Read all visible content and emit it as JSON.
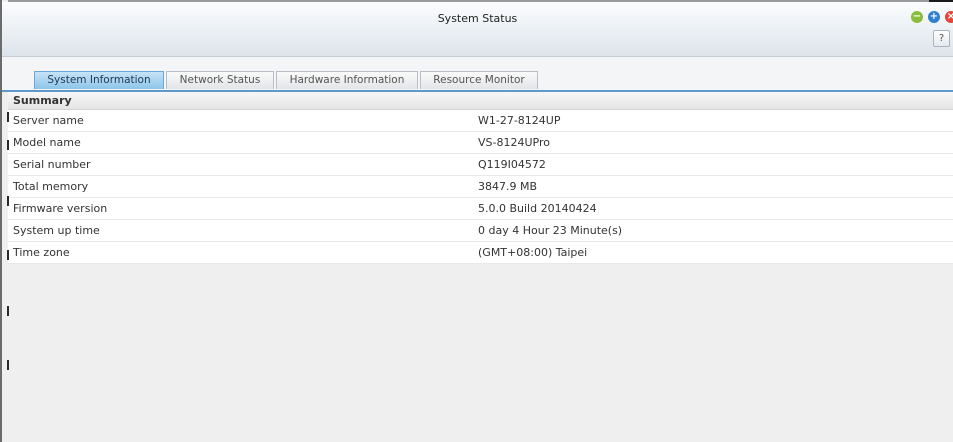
{
  "window": {
    "title": "System Status"
  },
  "controls": {
    "minimize": "−",
    "maximize": "+",
    "close": "×",
    "help": "?"
  },
  "tabs": [
    {
      "label": "System Information",
      "active": true
    },
    {
      "label": "Network Status",
      "active": false
    },
    {
      "label": "Hardware Information",
      "active": false
    },
    {
      "label": "Resource Monitor",
      "active": false
    }
  ],
  "summary": {
    "header": "Summary",
    "rows": [
      {
        "label": "Server name",
        "value": "W1-27-8124UP"
      },
      {
        "label": "Model name",
        "value": "VS-8124UPro"
      },
      {
        "label": "Serial number",
        "value": "Q119I04572"
      },
      {
        "label": "Total memory",
        "value": "3847.9 MB"
      },
      {
        "label": "Firmware version",
        "value": "5.0.0 Build 20140424"
      },
      {
        "label": "System up time",
        "value": "0 day 4 Hour 23 Minute(s)"
      },
      {
        "label": "Time zone",
        "value": "(GMT+08:00) Taipei"
      }
    ]
  },
  "colors": {
    "accent": "#6aa8d6",
    "minimize": "#8bbd3c",
    "maximize": "#2f7fd1",
    "close": "#e2453a"
  }
}
